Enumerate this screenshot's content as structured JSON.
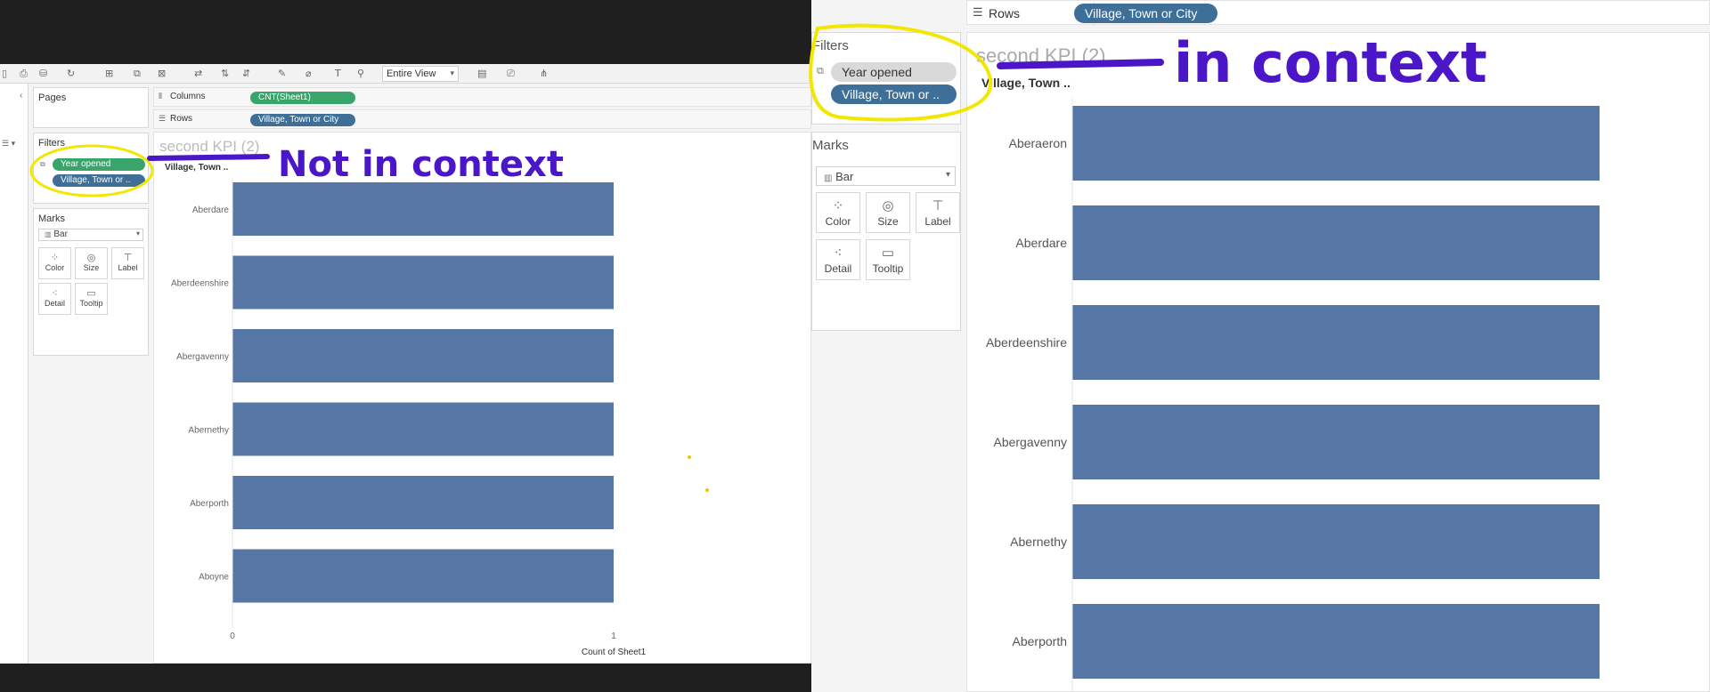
{
  "left_view": {
    "toolbar": {
      "view_select": "Entire View"
    },
    "pages_card": {
      "title": "Pages"
    },
    "filters_card": {
      "title": "Filters",
      "pills": [
        "Year opened",
        "Village, Town or .."
      ]
    },
    "marks_card": {
      "title": "Marks",
      "mark_type": "Bar",
      "buttons": [
        "Color",
        "Size",
        "Label",
        "Detail",
        "Tooltip"
      ]
    },
    "columns_shelf": {
      "label": "Columns",
      "pill": "CNT(Sheet1)"
    },
    "rows_shelf": {
      "label": "Rows",
      "pill": "Village, Town or City"
    },
    "viz": {
      "title": "second KPI (2)",
      "row_header": "Village, Town .."
    }
  },
  "right_view": {
    "rows_shelf": {
      "label": "Rows",
      "pill": "Village, Town or City"
    },
    "filters_card": {
      "title": "Filters",
      "pills": [
        "Year opened",
        "Village, Town or .."
      ]
    },
    "marks_card": {
      "title": "Marks",
      "mark_type": "Bar",
      "buttons": [
        "Color",
        "Size",
        "Label",
        "Detail",
        "Tooltip"
      ]
    },
    "viz": {
      "title": "second KPI (2)",
      "row_header": "Village, Town .."
    }
  },
  "annotations": {
    "left_note": "Not in context",
    "right_note": "in context"
  },
  "colors": {
    "bar": "#5677a6",
    "pill_green": "#3aa56b",
    "pill_blue": "#3d6f98",
    "pill_gray": "#d9d9d9",
    "highlight": "#f3e600",
    "ink": "#4a16c7"
  },
  "chart_data": [
    {
      "type": "bar",
      "orientation": "horizontal",
      "title": "second KPI (2)",
      "row_header": "Village, Town ..",
      "categories": [
        "Aberdare",
        "Aberdeenshire",
        "Abergavenny",
        "Abernethy",
        "Aberporth",
        "Aboyne"
      ],
      "values": [
        1,
        1,
        1,
        1,
        1,
        1
      ],
      "xlabel": "Count of Sheet1",
      "xticks": [
        "0",
        "1"
      ],
      "xlim": [
        0,
        1.5
      ]
    },
    {
      "type": "bar",
      "orientation": "horizontal",
      "title": "second KPI (2)",
      "row_header": "Village, Town ..",
      "categories": [
        "Aberaeron",
        "Aberdare",
        "Aberdeenshire",
        "Abergavenny",
        "Abernethy",
        "Aberporth"
      ],
      "values": [
        1,
        1,
        1,
        1,
        1,
        1
      ]
    }
  ]
}
